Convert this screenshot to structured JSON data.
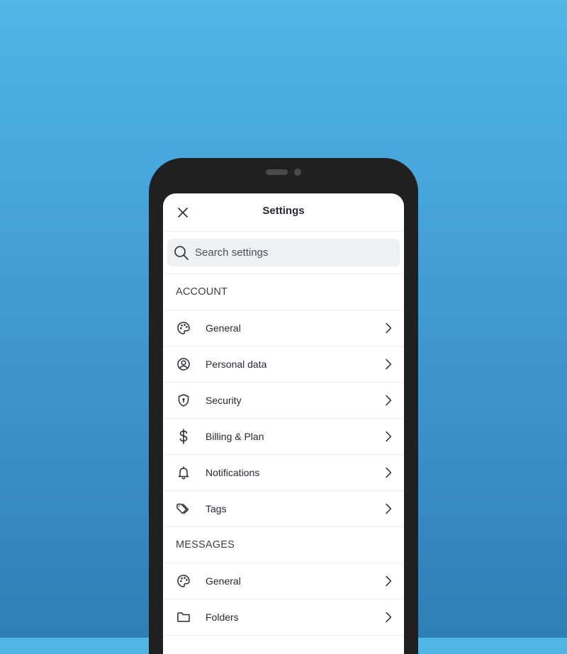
{
  "header": {
    "title": "Settings"
  },
  "search": {
    "placeholder": "Search settings"
  },
  "sections": [
    {
      "label": "ACCOUNT",
      "items": [
        {
          "label": "General",
          "icon": "palette-icon"
        },
        {
          "label": "Personal data",
          "icon": "user-circle-icon"
        },
        {
          "label": "Security",
          "icon": "shield-icon"
        },
        {
          "label": "Billing & Plan",
          "icon": "dollar-icon"
        },
        {
          "label": "Notifications",
          "icon": "bell-icon"
        },
        {
          "label": "Tags",
          "icon": "tags-icon"
        }
      ]
    },
    {
      "label": "MESSAGES",
      "items": [
        {
          "label": "General",
          "icon": "palette-icon"
        },
        {
          "label": "Folders",
          "icon": "folder-icon"
        }
      ]
    }
  ],
  "colors": {
    "background_top": "#50b6e6",
    "background_bottom": "#2f7fb6",
    "device": "#202020",
    "text": "#262a33",
    "search_bg": "#eef1f4"
  }
}
